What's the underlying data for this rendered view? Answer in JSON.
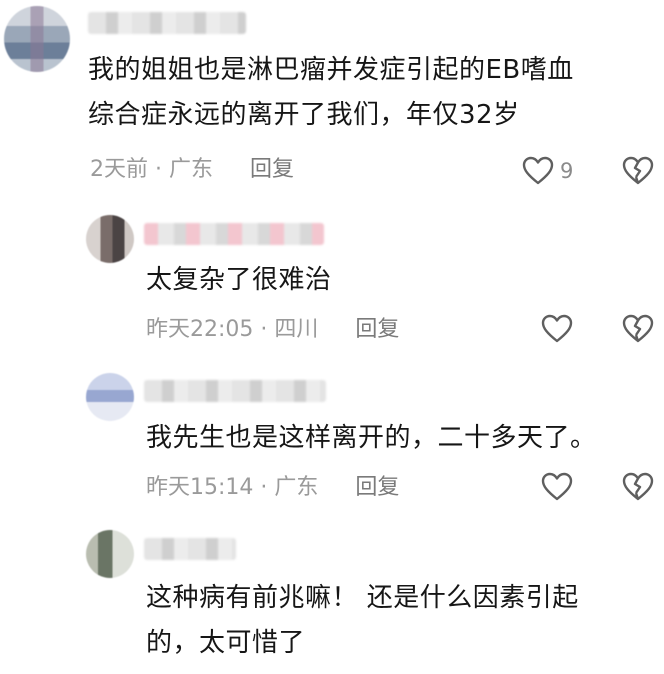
{
  "comments": [
    {
      "text_line1": "我的姐姐也是淋巴瘤并发症引起的EB嗜血",
      "text_line2": "综合症永远的离开了我们，年仅32岁",
      "time": "2天前",
      "location": "广东",
      "reply_label": "回复",
      "like_count": "9"
    },
    {
      "text_line1": "太复杂了很难治",
      "time": "昨天22:05",
      "location": "四川",
      "reply_label": "回复"
    },
    {
      "text_line1": "我先生也是这样离开的，二十多天了。",
      "time": "昨天15:14",
      "location": "广东",
      "reply_label": "回复"
    },
    {
      "text_line1": "这种病有前兆嘛！ 还是什么因素引起",
      "text_line2": "的，太可惜了"
    }
  ],
  "separator": "·",
  "icons": {
    "like": "heart-outline-icon",
    "dislike": "broken-heart-icon"
  },
  "colors": {
    "text": "#161616",
    "meta": "#9a9a9a",
    "icon": "#5f5f5f"
  }
}
